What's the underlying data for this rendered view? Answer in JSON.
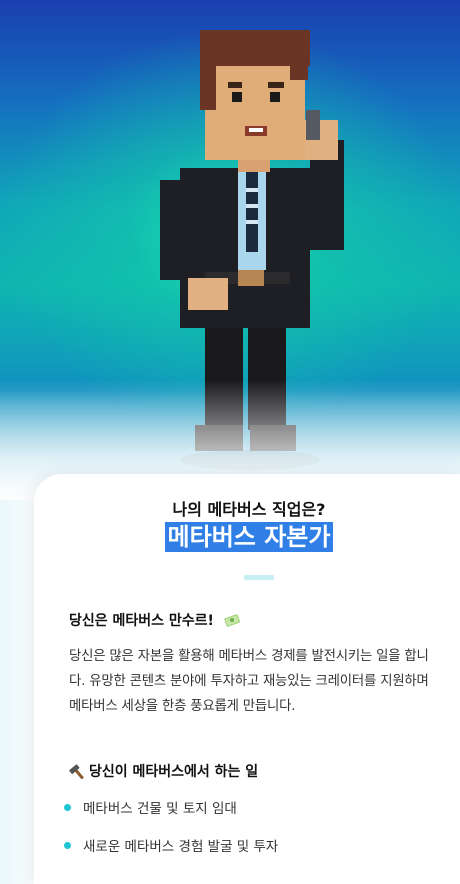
{
  "hero": {
    "avatar_icon": "voxel-businessman-avatar"
  },
  "card": {
    "subtitle": "나의 메타버스 직업은?",
    "job_title": "메타버스 자본가",
    "section1": {
      "heading": "당신은 메타버스 만수르!",
      "heading_icon": "money-icon",
      "body": "당신은 많은 자본을 활용해 메타버스 경제를 발전시키는 일을 합니다. 유망한 콘텐츠 분야에 투자하고 재능있는 크레이터를 지원하며 메타버스 세상을 한층 풍요롭게 만듭니다."
    },
    "section2": {
      "heading": "당신이 메타버스에서 하는 일",
      "heading_icon": "hammer-icon",
      "items": [
        "메타버스 건물 및 토지 임대",
        "새로운 메타버스 경험 발굴 및 투자"
      ]
    }
  },
  "colors": {
    "highlight": "#2f7fe6",
    "bullet": "#1ec3d6",
    "divider": "#c6eef3"
  }
}
